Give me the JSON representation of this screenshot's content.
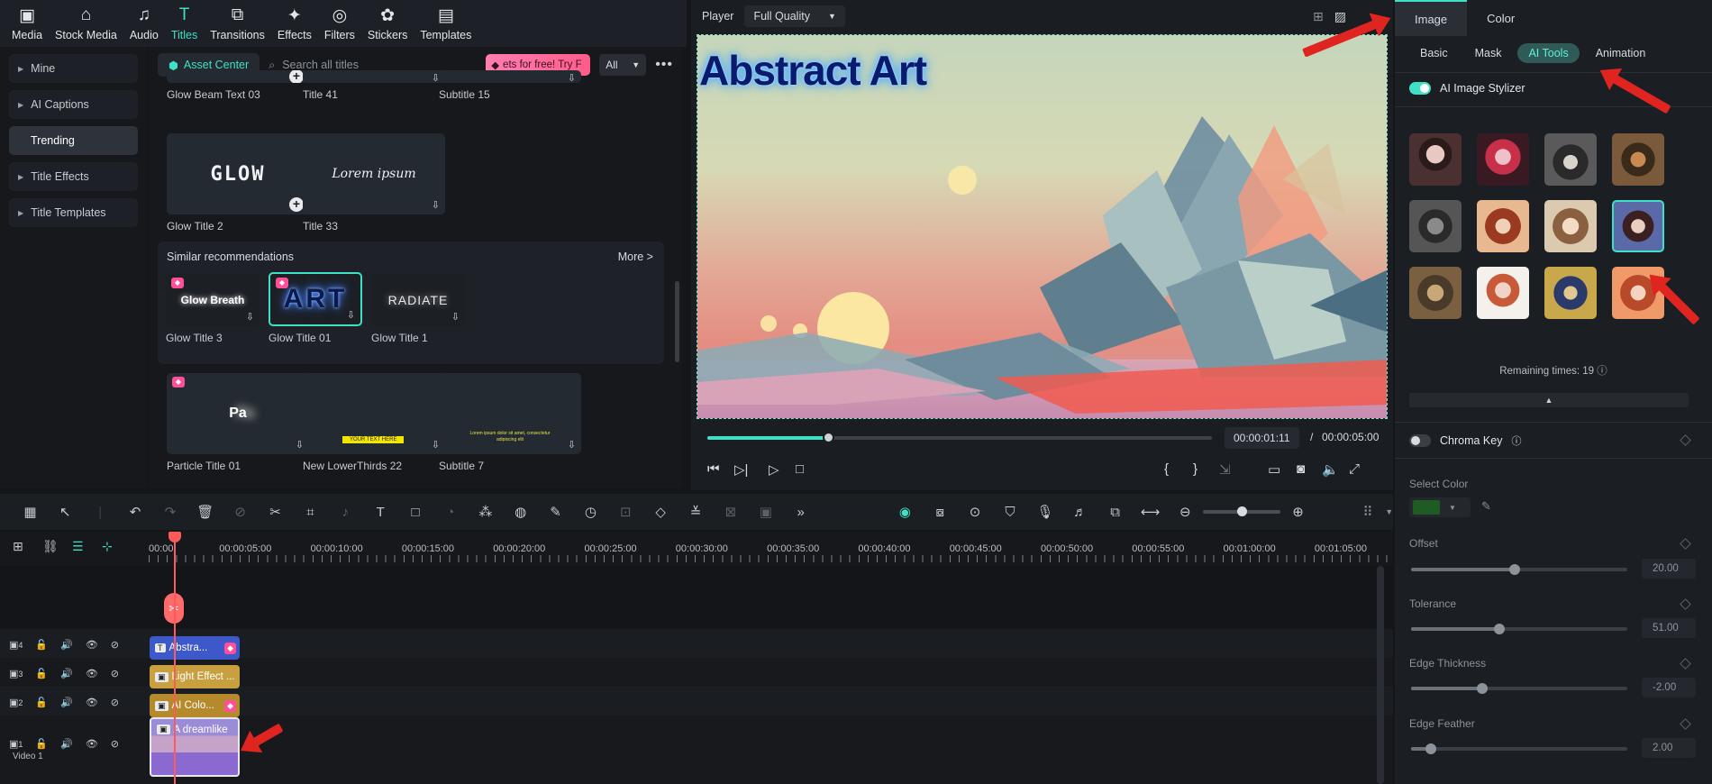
{
  "toolbar": {
    "items": [
      {
        "label": "Media",
        "icon": "media-icon"
      },
      {
        "label": "Stock Media",
        "icon": "stock-media-icon"
      },
      {
        "label": "Audio",
        "icon": "audio-icon"
      },
      {
        "label": "Titles",
        "icon": "titles-icon"
      },
      {
        "label": "Transitions",
        "icon": "transitions-icon"
      },
      {
        "label": "Effects",
        "icon": "effects-icon"
      },
      {
        "label": "Filters",
        "icon": "filters-icon"
      },
      {
        "label": "Stickers",
        "icon": "stickers-icon"
      },
      {
        "label": "Templates",
        "icon": "templates-icon"
      }
    ],
    "active": "Titles"
  },
  "sidebar": {
    "items": [
      {
        "label": "Mine"
      },
      {
        "label": "AI Captions"
      },
      {
        "label": "Trending"
      },
      {
        "label": "Title Effects"
      },
      {
        "label": "Title Templates"
      }
    ]
  },
  "browser": {
    "asset_center": "Asset Center",
    "search_placeholder": "Search all titles",
    "promo": "ets for free! Try F",
    "filter": "All",
    "top_row": [
      "Glow Beam Text 03",
      "Title 41",
      "Subtitle 15"
    ],
    "row2": [
      {
        "name": "Glow Title 2",
        "thumb_text": "GLOW"
      },
      {
        "name": "Title 33",
        "thumb_text": "Lorem ipsum"
      }
    ],
    "similar_title": "Similar recommendations",
    "more": "More >",
    "similar": [
      {
        "name": "Glow Title 3",
        "thumb_text": "Glow Breath"
      },
      {
        "name": "Glow Title 01",
        "thumb_text": "ART"
      },
      {
        "name": "Glow Title 1",
        "thumb_text": "RADIATE"
      }
    ],
    "bottom_row": [
      {
        "name": "Particle Title 01",
        "thumb_text": "Pa"
      },
      {
        "name": "New LowerThirds 22",
        "thumb_text": "YOUR TEXT HERE"
      },
      {
        "name": "Subtitle 7",
        "thumb_text": "Lorem ipsum dolor sit amet, consectetur adipiscing elit"
      }
    ]
  },
  "player": {
    "label": "Player",
    "quality": "Full Quality",
    "overlay_title": "Abstract Art",
    "current_time": "00:00:01:11",
    "separator": "/",
    "total_time": "00:00:05:00",
    "progress": 0.24
  },
  "properties": {
    "tabs": [
      "Image",
      "Color"
    ],
    "subtabs": [
      "Basic",
      "Mask",
      "AI Tools",
      "Animation"
    ],
    "active_subtab": "AI Tools",
    "stylizer_label": "AI Image Stylizer",
    "remaining": "Remaining times: 19",
    "chroma_label": "Chroma Key",
    "select_color": "Select Color",
    "select_color_value": "#1f5c23",
    "params": [
      {
        "label": "Offset",
        "value": "20.00",
        "level": 0.48
      },
      {
        "label": "Tolerance",
        "value": "51.00",
        "level": 0.41
      },
      {
        "label": "Edge Thickness",
        "value": "-2.00",
        "level": 0.33
      },
      {
        "label": "Edge Feather",
        "value": "2.00",
        "level": 0.09
      }
    ]
  },
  "timeline": {
    "ticks": [
      "00:00",
      "00:00:05:00",
      "00:00:10:00",
      "00:00:15:00",
      "00:00:20:00",
      "00:00:25:00",
      "00:00:30:00",
      "00:00:35:00",
      "00:00:40:00",
      "00:00:45:00",
      "00:00:50:00",
      "00:00:55:00",
      "00:01:00:00",
      "00:01:05:00"
    ],
    "tracks": [
      {
        "num": "4",
        "clip": "Abstra...",
        "color": "#3d58c8"
      },
      {
        "num": "3",
        "clip": "Light Effect ...",
        "color": "#c8a040"
      },
      {
        "num": "2",
        "clip": "AI Colo...",
        "color": "#b58a2c"
      },
      {
        "num": "1",
        "clip": "A dreamlike",
        "color": "#7a63c9"
      }
    ],
    "video_label": "Video 1"
  },
  "colors": {
    "accent": "#3fe0c6",
    "arrow": "#e0241f",
    "playhead": "#ff5a5a"
  }
}
